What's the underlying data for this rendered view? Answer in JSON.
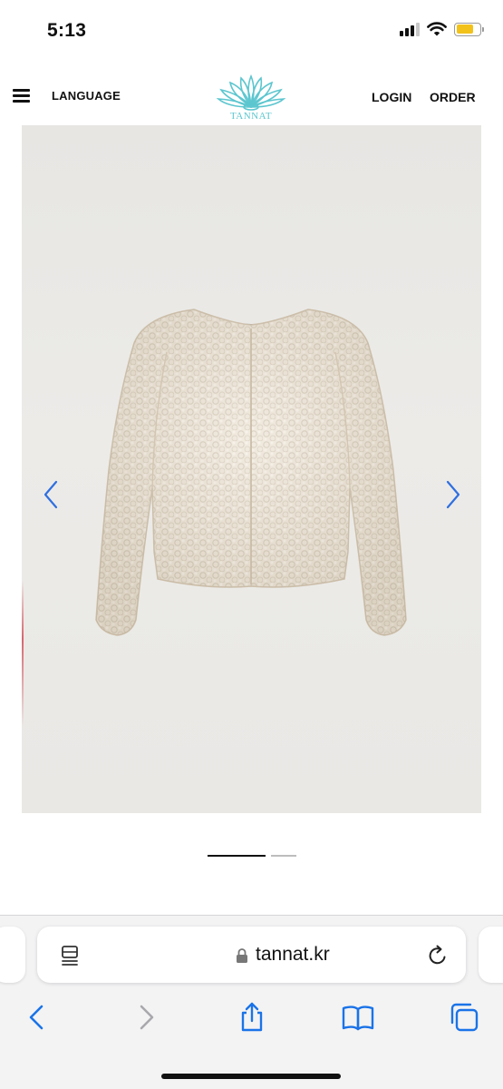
{
  "status_bar": {
    "time": "5:13",
    "battery_level": 0.75,
    "battery_color": "#f2c21b",
    "signal_bars_active": 3,
    "icons": [
      "cellular-signal-icon",
      "wifi-icon",
      "battery-icon"
    ]
  },
  "site_header": {
    "menu_icon": "hamburger-menu-icon",
    "language_label": "LANGUAGE",
    "brand_name": "TANNAT",
    "login_label": "LOGIN",
    "order_label": "ORDER",
    "brand_color": "#5cc6cf"
  },
  "carousel": {
    "prev_icon": "chevron-left-icon",
    "next_icon": "chevron-right-icon",
    "arrow_color": "#2f6fe0",
    "total_slides": 2,
    "active_slide": 1
  },
  "browser": {
    "url": "tannat.kr",
    "address_icons": [
      "reader-mode-icon",
      "lock-icon",
      "reload-icon"
    ],
    "toolbar_icons": [
      "back-icon",
      "forward-icon",
      "share-icon",
      "bookmarks-icon",
      "tabs-icon"
    ],
    "accent_color": "#1a73e8"
  }
}
